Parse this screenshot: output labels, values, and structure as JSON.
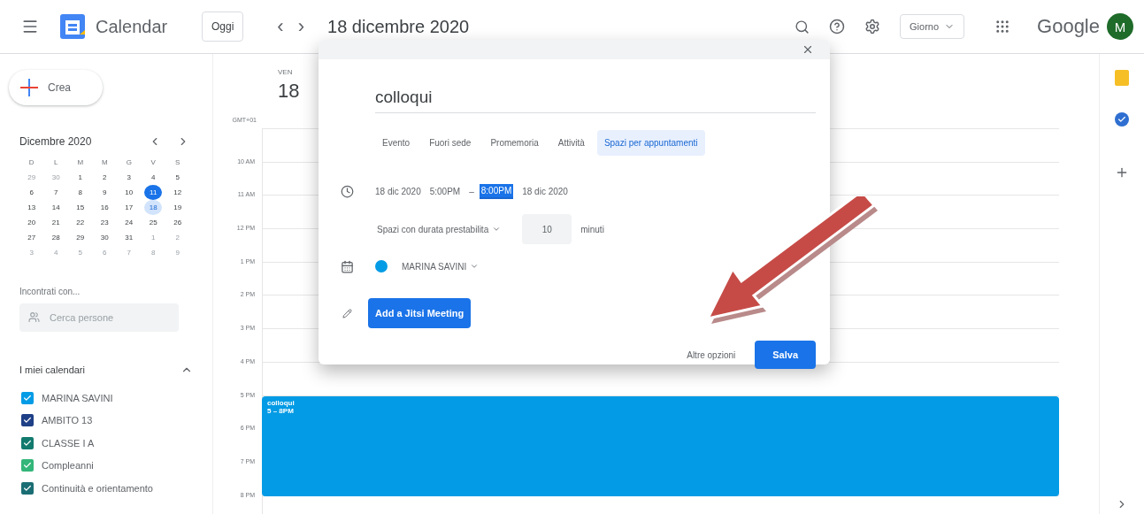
{
  "header": {
    "app_name": "Calendar",
    "today_button": "Oggi",
    "prev": "‹",
    "next": "›",
    "date_title": "18 dicembre 2020",
    "view_select": "Giorno",
    "brand": "Google",
    "avatar": "M"
  },
  "sidebar": {
    "create_button": "Crea",
    "mini_calendar": {
      "title": "Dicembre 2020",
      "weekdays": [
        "D",
        "L",
        "M",
        "M",
        "G",
        "V",
        "S"
      ],
      "weeks": [
        [
          {
            "d": "29",
            "kind": "other"
          },
          {
            "d": "30",
            "kind": "other"
          },
          {
            "d": "1",
            "kind": "normal"
          },
          {
            "d": "2",
            "kind": "normal"
          },
          {
            "d": "3",
            "kind": "normal"
          },
          {
            "d": "4",
            "kind": "normal"
          },
          {
            "d": "5",
            "kind": "normal"
          }
        ],
        [
          {
            "d": "6",
            "kind": "normal"
          },
          {
            "d": "7",
            "kind": "normal"
          },
          {
            "d": "8",
            "kind": "normal"
          },
          {
            "d": "9",
            "kind": "normal"
          },
          {
            "d": "10",
            "kind": "normal"
          },
          {
            "d": "11",
            "kind": "today"
          },
          {
            "d": "12",
            "kind": "normal"
          }
        ],
        [
          {
            "d": "13",
            "kind": "normal"
          },
          {
            "d": "14",
            "kind": "normal"
          },
          {
            "d": "15",
            "kind": "normal"
          },
          {
            "d": "16",
            "kind": "normal"
          },
          {
            "d": "17",
            "kind": "normal"
          },
          {
            "d": "18",
            "kind": "selected"
          },
          {
            "d": "19",
            "kind": "normal"
          }
        ],
        [
          {
            "d": "20",
            "kind": "normal"
          },
          {
            "d": "21",
            "kind": "normal"
          },
          {
            "d": "22",
            "kind": "normal"
          },
          {
            "d": "23",
            "kind": "normal"
          },
          {
            "d": "24",
            "kind": "normal"
          },
          {
            "d": "25",
            "kind": "normal"
          },
          {
            "d": "26",
            "kind": "normal"
          }
        ],
        [
          {
            "d": "27",
            "kind": "normal"
          },
          {
            "d": "28",
            "kind": "normal"
          },
          {
            "d": "29",
            "kind": "normal"
          },
          {
            "d": "30",
            "kind": "normal"
          },
          {
            "d": "31",
            "kind": "normal"
          },
          {
            "d": "1",
            "kind": "other"
          },
          {
            "d": "2",
            "kind": "other"
          }
        ],
        [
          {
            "d": "3",
            "kind": "other"
          },
          {
            "d": "4",
            "kind": "other"
          },
          {
            "d": "5",
            "kind": "other"
          },
          {
            "d": "6",
            "kind": "other"
          },
          {
            "d": "7",
            "kind": "other"
          },
          {
            "d": "8",
            "kind": "other"
          },
          {
            "d": "9",
            "kind": "other"
          }
        ]
      ]
    },
    "meet_label": "Incontrati con...",
    "people_search": {
      "placeholder": "Cerca persone"
    },
    "my_calendars": {
      "title": "I miei calendari",
      "expanded": true,
      "items": [
        {
          "name": "MARINA SAVINI",
          "checked": true,
          "color": "#039be5"
        },
        {
          "name": "AMBITO 13",
          "checked": true,
          "color": "#1f3f86"
        },
        {
          "name": "CLASSE I A",
          "checked": true,
          "color": "#137a6e"
        },
        {
          "name": "Compleanni",
          "checked": true,
          "color": "#33b679"
        },
        {
          "name": "Continuità e orientamento",
          "checked": true,
          "color": "#1a6e73"
        }
      ]
    }
  },
  "day_view": {
    "weekday": "VEN",
    "day": "18",
    "timezone": "GMT+01",
    "hours": [
      {
        "label": "10 AM"
      },
      {
        "label": "11 AM"
      },
      {
        "label": "12 PM"
      },
      {
        "label": "1 PM"
      },
      {
        "label": "2 PM"
      },
      {
        "label": "3 PM"
      },
      {
        "label": "4 PM"
      },
      {
        "label": "5 PM",
        "event": {
          "title": "colloqui",
          "time": "5 – 8PM",
          "color": "#039be5"
        }
      },
      {
        "label": "6 PM"
      },
      {
        "label": "7 PM"
      },
      {
        "label": "8 PM"
      }
    ]
  },
  "dialog": {
    "title_value": "colloqui",
    "tabs": [
      {
        "label": "Evento",
        "selected": false
      },
      {
        "label": "Fuori sede",
        "selected": false
      },
      {
        "label": "Promemoria",
        "selected": false
      },
      {
        "label": "Attività",
        "selected": false
      },
      {
        "label": "Spazi per appuntamenti",
        "selected": true
      }
    ],
    "start_date": "18 dic 2020",
    "start_time": "5:00PM",
    "dash": "–",
    "end_time": "8:00PM",
    "end_date": "18 dic 2020",
    "slot_mode": "Spazi con durata prestabilita",
    "slot_length": "10",
    "slot_unit": "minuti",
    "calendar": {
      "name": "MARINA SAVINI",
      "color": "#039be5"
    },
    "jitsi_button": "Add a Jitsi Meeting",
    "more_options": "Altre opzioni",
    "save_button": "Salva"
  }
}
